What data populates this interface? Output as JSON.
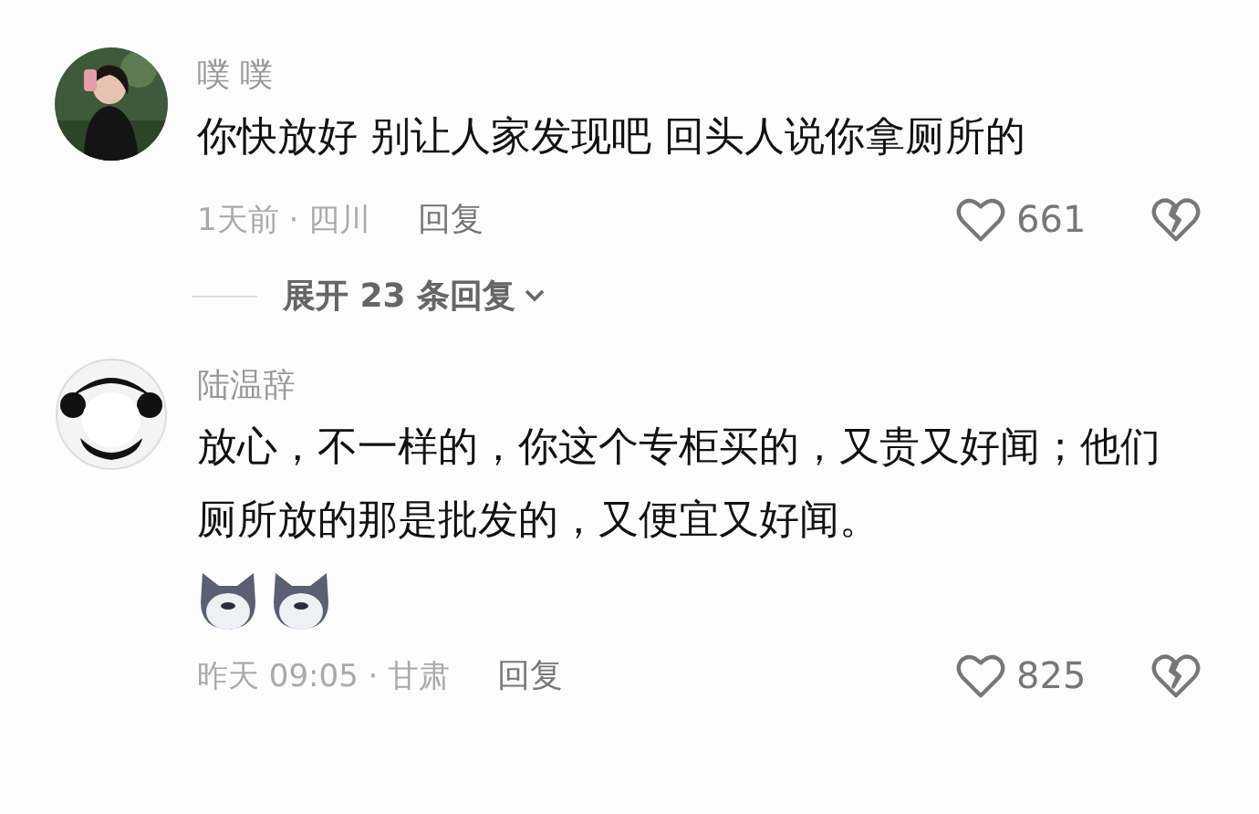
{
  "comments": [
    {
      "username": "噗 噗",
      "text": "你快放好 别让人家发现吧 回头人说你拿厕所的",
      "time_location": "1天前 · 四川",
      "reply_label": "回复",
      "likes": "661",
      "expand_replies": {
        "label": "展开 23 条回复",
        "expanded": false
      }
    },
    {
      "avatar": {
        "kind": "cartoon"
      },
      "username": "陆温辞",
      "text": "放心，不一样的，你这个专柜买的，又贵又好闻；他们厕所放的那是批发的，又便宜又好闻。",
      "stickers": [
        {
          "kind": "dog"
        },
        {
          "kind": "dog"
        }
      ],
      "time_location": "昨天 09:05 · 甘肃",
      "reply_label": "回复",
      "likes": "825"
    }
  ]
}
